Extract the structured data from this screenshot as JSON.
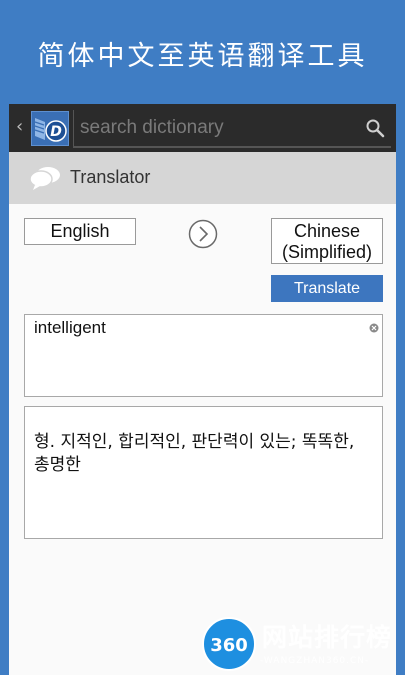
{
  "banner": {
    "title": "简体中文至英语翻译工具"
  },
  "actionbar": {
    "back_icon": "chevron-left-icon",
    "logo_icon": "dictionary-logo-icon",
    "logo_letter": "D",
    "search_placeholder": "search dictionary",
    "search_value": ""
  },
  "panel": {
    "title": "Translator",
    "icon": "speech-bubbles-icon"
  },
  "languages": {
    "source": "English",
    "target_line1": "Chinese",
    "target_line2": "(Simplified)",
    "swap_icon": "chevron-right-circle-icon"
  },
  "translate_button": {
    "label": "Translate"
  },
  "input": {
    "text": "intelligent",
    "clear_icon": "clear-x-icon"
  },
  "output": {
    "text": "형. 지적인, 합리적인, 판단력이 있는; 똑똑한, 총명한"
  },
  "watermark": {
    "badge": "360",
    "text": "网站排行榜",
    "subtext": "-WANGZHAN360.CN-"
  },
  "colors": {
    "banner": "#3f7dc4",
    "actionbar": "#2b2b2b",
    "accent": "#3d76bf",
    "header_bg": "#d6d6d6"
  }
}
